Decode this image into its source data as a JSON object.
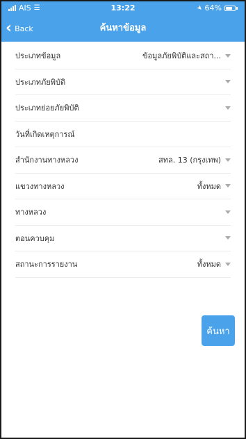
{
  "status_bar": {
    "carrier": "AIS",
    "time": "13:22",
    "battery": "64%"
  },
  "navbar": {
    "back_label": "Back",
    "title": "ค้นหาข้อมูล"
  },
  "form": {
    "fields": [
      {
        "label": "ประเภทข้อมูล",
        "value": "ข้อมูลภัยพิบัติและสถา..."
      },
      {
        "label": "ประเภทภัยพิบัติ",
        "value": ""
      },
      {
        "label": "ประเภทย่อยภัยพิบัติ",
        "value": ""
      },
      {
        "label": "วันที่เกิดเหตุการณ์",
        "value": ""
      },
      {
        "label": "สำนักงานทางหลวง",
        "value": "สทล. 13 (กรุงเทพ)"
      },
      {
        "label": "แขวงทางหลวง",
        "value": "ทั้งหมด"
      },
      {
        "label": "ทางหลวง",
        "value": ""
      },
      {
        "label": "ตอนควบคุม",
        "value": ""
      },
      {
        "label": "สถานะการรายงาน",
        "value": "ทั้งหมด"
      }
    ]
  },
  "search_button": {
    "label": "ค้นหา"
  },
  "colors": {
    "accent": "#4aa3ea",
    "divider": "#ececec",
    "caret": "#aaaaaa"
  }
}
